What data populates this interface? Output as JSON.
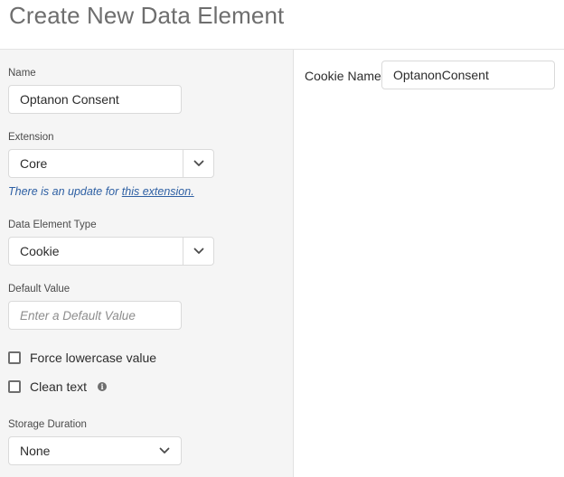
{
  "page": {
    "title": "Create New Data Element"
  },
  "form": {
    "name": {
      "label": "Name",
      "value": "Optanon Consent"
    },
    "extension": {
      "label": "Extension",
      "value": "Core"
    },
    "update_notice": {
      "text": "There is an update for ",
      "link_text": "this extension."
    },
    "data_element_type": {
      "label": "Data Element Type",
      "value": "Cookie"
    },
    "default_value": {
      "label": "Default Value",
      "placeholder": "Enter a Default Value"
    },
    "force_lowercase": {
      "label": "Force lowercase value",
      "checked": false
    },
    "clean_text": {
      "label": "Clean text",
      "checked": false,
      "info_glyph": "i"
    },
    "storage_duration": {
      "label": "Storage Duration",
      "value": "None"
    }
  },
  "settings": {
    "cookie_name": {
      "label": "Cookie Name",
      "value": "OptanonConsent"
    }
  }
}
